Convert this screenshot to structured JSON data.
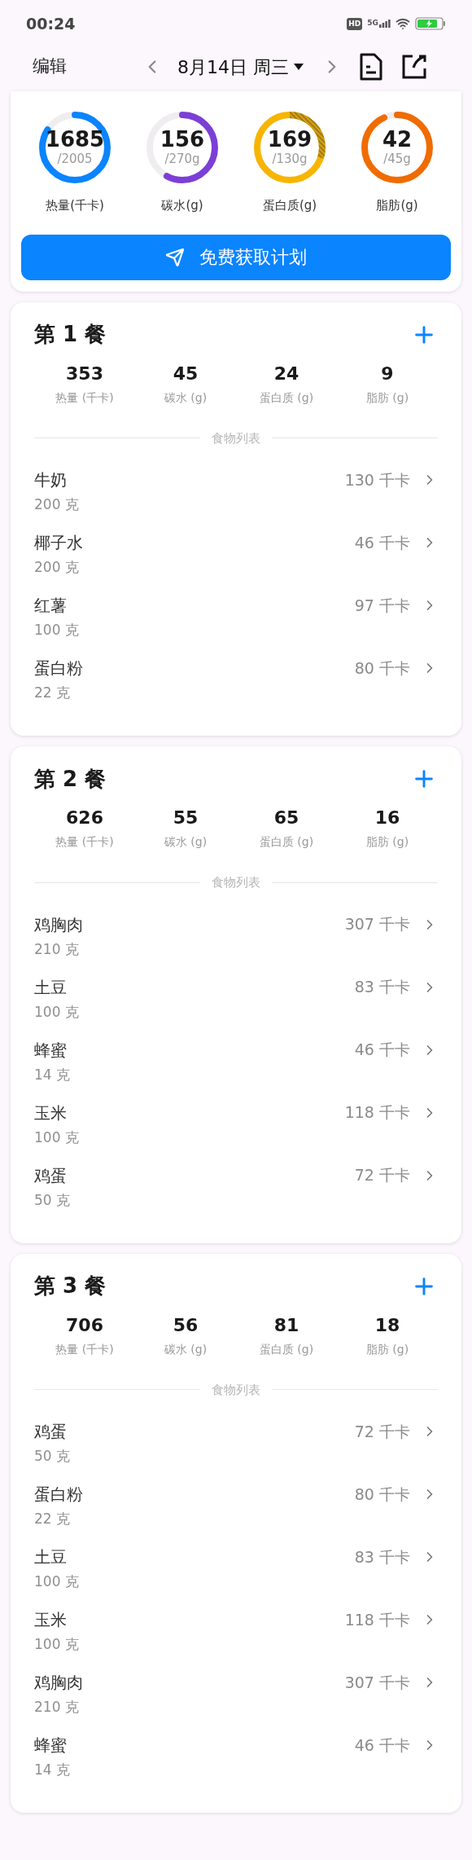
{
  "status_bar": {
    "time": "00:24",
    "hd": "HD",
    "network": "5G"
  },
  "header": {
    "edit": "编辑",
    "date": "8月14日 周三"
  },
  "summary": {
    "rings": [
      {
        "value": "1685",
        "goal": "/2005",
        "label": "热量(千卡)",
        "color": "#0a84ff"
      },
      {
        "value": "156",
        "goal": "/270g",
        "label": "碳水(g)",
        "color": "#7b3fd6"
      },
      {
        "value": "169",
        "goal": "/130g",
        "label": "蛋白质(g)",
        "color": "#f7b500"
      },
      {
        "value": "42",
        "goal": "/45g",
        "label": "脂肪(g)",
        "color": "#f06c00"
      }
    ],
    "button": "免费获取计划"
  },
  "meals": [
    {
      "title": "第 1 餐",
      "totals": [
        {
          "value": "353",
          "label": "热量 (千卡)"
        },
        {
          "value": "45",
          "label": "碳水 (g)"
        },
        {
          "value": "24",
          "label": "蛋白质 (g)"
        },
        {
          "value": "9",
          "label": "脂肪 (g)"
        }
      ],
      "list_title": "食物列表",
      "foods": [
        {
          "name": "牛奶",
          "amount": "200 克",
          "kcal": "130 千卡"
        },
        {
          "name": "椰子水",
          "amount": "200 克",
          "kcal": "46 千卡"
        },
        {
          "name": "红薯",
          "amount": "100 克",
          "kcal": "97 千卡"
        },
        {
          "name": "蛋白粉",
          "amount": "22 克",
          "kcal": "80 千卡"
        }
      ]
    },
    {
      "title": "第 2 餐",
      "totals": [
        {
          "value": "626",
          "label": "热量 (千卡)"
        },
        {
          "value": "55",
          "label": "碳水 (g)"
        },
        {
          "value": "65",
          "label": "蛋白质 (g)"
        },
        {
          "value": "16",
          "label": "脂肪 (g)"
        }
      ],
      "list_title": "食物列表",
      "foods": [
        {
          "name": "鸡胸肉",
          "amount": "210 克",
          "kcal": "307 千卡"
        },
        {
          "name": "土豆",
          "amount": "100 克",
          "kcal": "83 千卡"
        },
        {
          "name": "蜂蜜",
          "amount": "14 克",
          "kcal": "46 千卡"
        },
        {
          "name": "玉米",
          "amount": "100 克",
          "kcal": "118 千卡"
        },
        {
          "name": "鸡蛋",
          "amount": "50 克",
          "kcal": "72 千卡"
        }
      ]
    },
    {
      "title": "第 3 餐",
      "totals": [
        {
          "value": "706",
          "label": "热量 (千卡)"
        },
        {
          "value": "56",
          "label": "碳水 (g)"
        },
        {
          "value": "81",
          "label": "蛋白质 (g)"
        },
        {
          "value": "18",
          "label": "脂肪 (g)"
        }
      ],
      "list_title": "食物列表",
      "foods": [
        {
          "name": "鸡蛋",
          "amount": "50 克",
          "kcal": "72 千卡"
        },
        {
          "name": "蛋白粉",
          "amount": "22 克",
          "kcal": "80 千卡"
        },
        {
          "name": "土豆",
          "amount": "100 克",
          "kcal": "83 千卡"
        },
        {
          "name": "玉米",
          "amount": "100 克",
          "kcal": "118 千卡"
        },
        {
          "name": "鸡胸肉",
          "amount": "210 克",
          "kcal": "307 千卡"
        },
        {
          "name": "蜂蜜",
          "amount": "14 克",
          "kcal": "46 千卡"
        }
      ]
    }
  ]
}
